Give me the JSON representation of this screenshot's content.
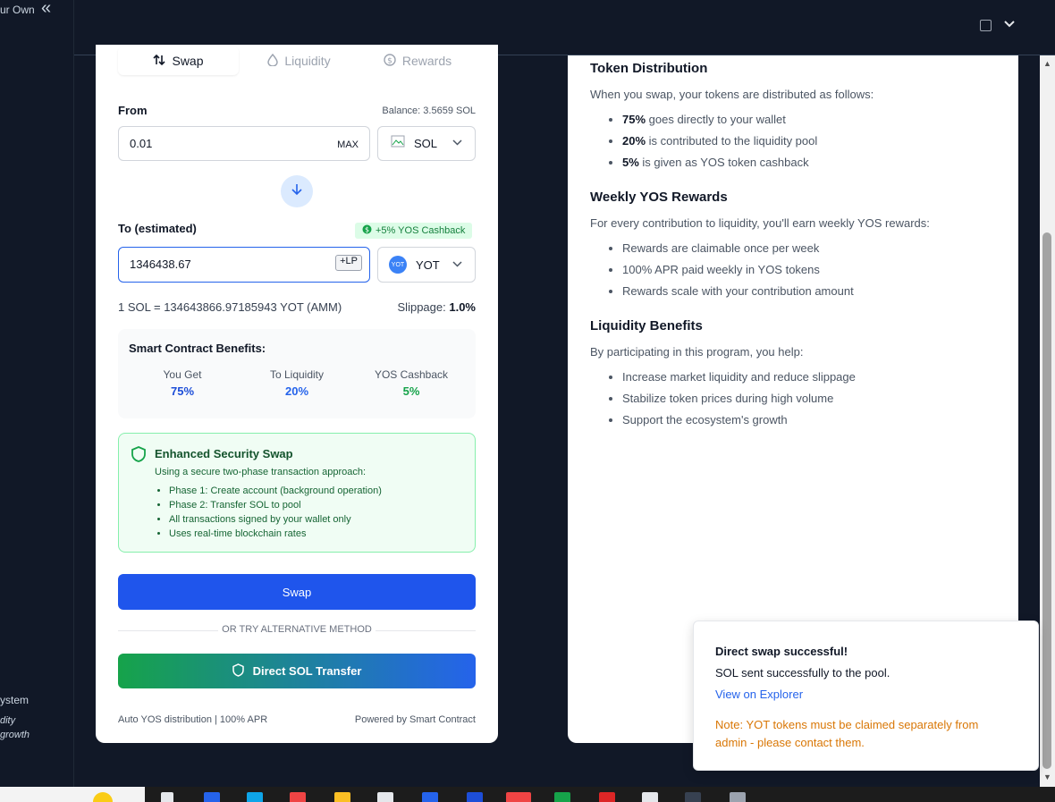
{
  "sidebar": {
    "top_text": "ur Own",
    "cut_lines": [
      "ystem",
      "dity",
      "growth"
    ]
  },
  "topbar": {},
  "tabs": [
    {
      "label": "Swap",
      "icon": "swap-arrows-icon",
      "active": true
    },
    {
      "label": "Liquidity",
      "icon": "droplet-icon",
      "active": false
    },
    {
      "label": "Rewards",
      "icon": "coin-icon",
      "active": false
    }
  ],
  "from": {
    "label": "From",
    "balance": "Balance: 3.5659 SOL",
    "amount": "0.01",
    "max_label": "MAX",
    "token": "SOL"
  },
  "to": {
    "label": "To (estimated)",
    "cashback_badge": "+5% YOS Cashback",
    "amount": "1346438.67",
    "lp_badge": "+LP",
    "token": "YOT",
    "token_logo_text": "YOT"
  },
  "rate_text": "1 SOL = 134643866.97185943 YOT (AMM)",
  "slippage": {
    "label": "Slippage:",
    "value": "1.0%"
  },
  "benefits": {
    "title": "Smart Contract Benefits:",
    "items": [
      {
        "label": "You Get",
        "value": "75%",
        "color": "#1d4ed8"
      },
      {
        "label": "To Liquidity",
        "value": "20%",
        "color": "#2563eb"
      },
      {
        "label": "YOS Cashback",
        "value": "5%",
        "color": "#16a34a"
      }
    ]
  },
  "security": {
    "title": "Enhanced Security Swap",
    "description": "Using a secure two-phase transaction approach:",
    "points": [
      "Phase 1: Create account (background operation)",
      "Phase 2: Transfer SOL to pool",
      "All transactions signed by your wallet only",
      "Uses real-time blockchain rates"
    ]
  },
  "swap_button": "Swap",
  "alt_divider": "OR TRY ALTERNATIVE METHOD",
  "direct_button": "Direct SOL Transfer",
  "footer": {
    "left": "Auto YOS distribution | 100% APR",
    "right": "Powered by Smart Contract"
  },
  "info": {
    "distribution": {
      "title": "Token Distribution",
      "intro": "When you swap, your tokens are distributed as follows:",
      "items": [
        {
          "bold": "75%",
          "text": " goes directly to your wallet"
        },
        {
          "bold": "20%",
          "text": " is contributed to the liquidity pool"
        },
        {
          "bold": "5%",
          "text": " is given as YOS token cashback"
        }
      ]
    },
    "weekly": {
      "title": "Weekly YOS Rewards",
      "intro": "For every contribution to liquidity, you'll earn weekly YOS rewards:",
      "items": [
        "Rewards are claimable once per week",
        "100% APR paid weekly in YOS tokens",
        "Rewards scale with your contribution amount"
      ]
    },
    "benefits": {
      "title": "Liquidity Benefits",
      "intro": "By participating in this program, you help:",
      "items": [
        "Increase market liquidity and reduce slippage",
        "Stabilize token prices during high volume",
        "Support the ecosystem's growth"
      ]
    }
  },
  "toast": {
    "title": "Direct swap successful!",
    "message": "SOL sent successfully to the pool.",
    "link": "View on Explorer",
    "note": "Note: YOT tokens must be claimed separately from admin - please contact them."
  }
}
